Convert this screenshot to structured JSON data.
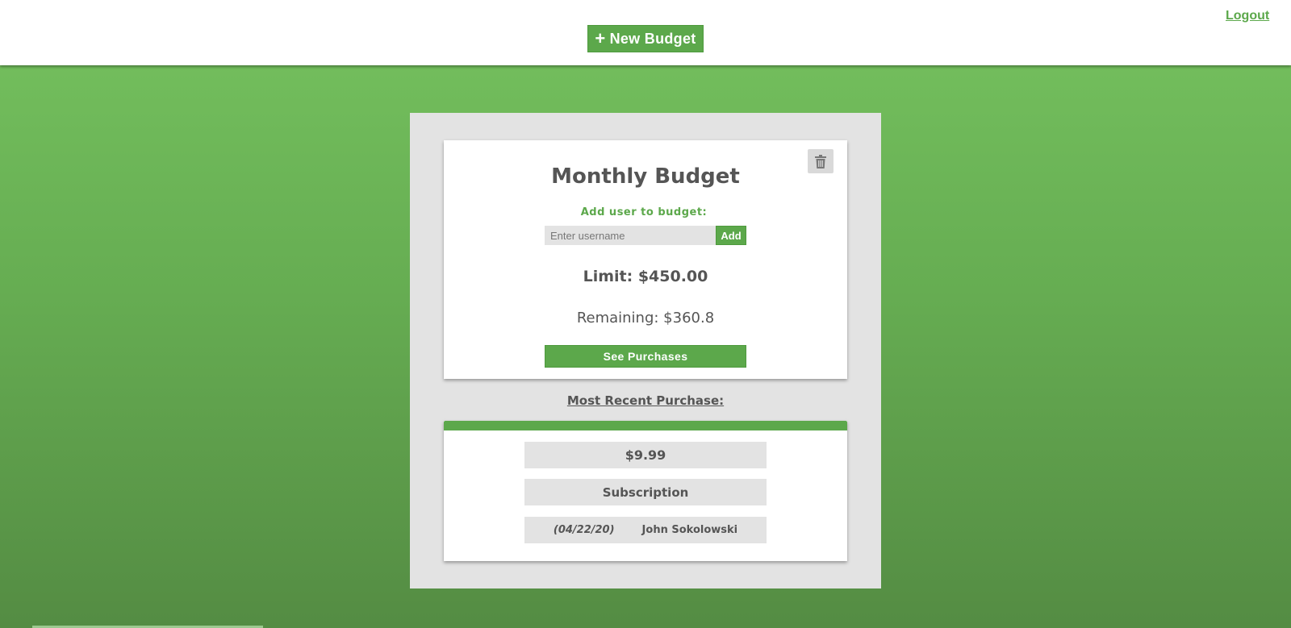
{
  "header": {
    "new_budget_label": "New Budget",
    "new_budget_icon": "plus-icon",
    "logout_label": "Logout"
  },
  "budget": {
    "title": "Monthly Budget",
    "add_user_label": "Add user to budget:",
    "username_placeholder": "Enter username",
    "username_value": "",
    "add_button_label": "Add",
    "limit_text": "Limit: $450.00",
    "remaining_text": "Remaining: $360.8",
    "see_purchases_label": "See Purchases",
    "delete_icon": "trash-icon"
  },
  "recent_purchase": {
    "heading": "Most Recent Purchase:",
    "amount": "$9.99",
    "category": "Subscription",
    "date": "(04/22/20)",
    "user": "John Sokolowski"
  },
  "colors": {
    "accent": "#5ca84b",
    "background_top": "#72bd5c",
    "background_bottom": "#548c43",
    "panel": "#e3e3e3",
    "text": "#555555"
  }
}
